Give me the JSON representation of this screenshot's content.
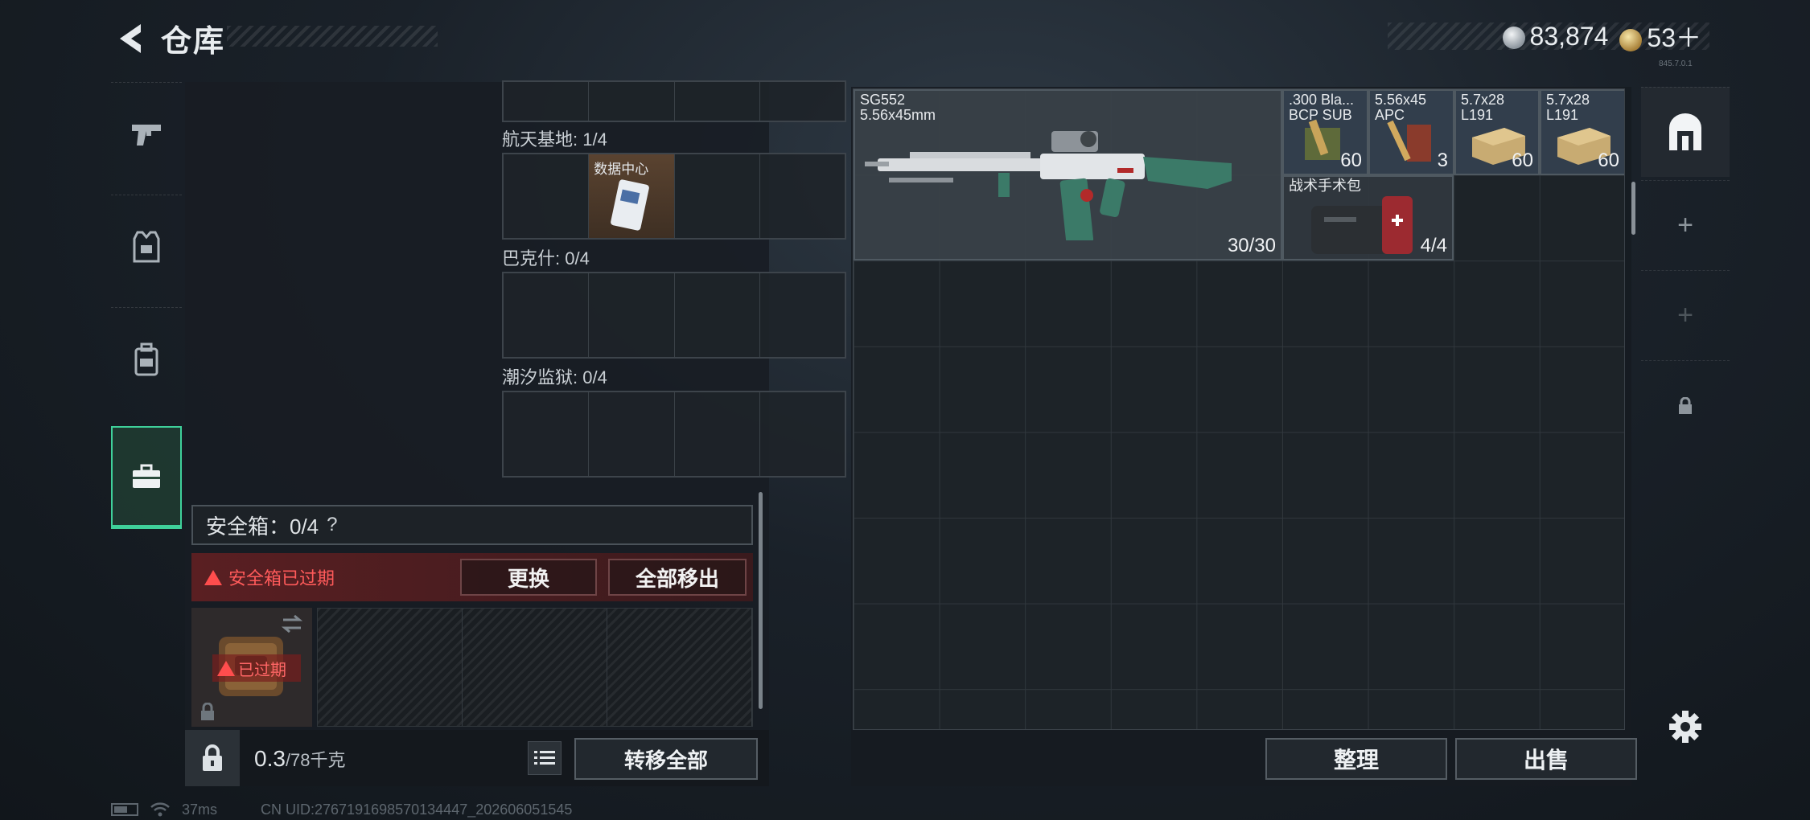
{
  "header": {
    "title": "仓库",
    "currency_silver": "83,874",
    "currency_gold": "53＋",
    "version": "845.7.0.1"
  },
  "left_tabs": [
    {
      "name": "weapons",
      "icon": "pistol-icon",
      "active": false
    },
    {
      "name": "armor",
      "icon": "vest-icon",
      "active": false
    },
    {
      "name": "backpack",
      "icon": "backpack-icon",
      "active": false
    },
    {
      "name": "safebox",
      "icon": "briefcase-icon",
      "active": true
    }
  ],
  "key_areas": [
    {
      "label": "航天基地: 1/4",
      "slots": [
        {
          "filled": false
        },
        {
          "filled": true,
          "label": "数据中心"
        },
        {
          "filled": false
        },
        {
          "filled": false
        }
      ]
    },
    {
      "label": "巴克什: 0/4",
      "slots": [
        {
          "filled": false
        },
        {
          "filled": false
        },
        {
          "filled": false
        },
        {
          "filled": false
        }
      ]
    },
    {
      "label": "潮汐监狱: 0/4",
      "slots": [
        {
          "filled": false
        },
        {
          "filled": false
        },
        {
          "filled": false
        },
        {
          "filled": false
        }
      ]
    }
  ],
  "safebox": {
    "title": "安全箱：0/4",
    "help": "?",
    "expired_text": "安全箱已过期",
    "replace_label": "更换",
    "remove_all_label": "全部移出",
    "overdue_label": "已过期"
  },
  "left_footer": {
    "weight_value": "0.3",
    "weight_max": "/78千克",
    "transfer_all_label": "转移全部"
  },
  "stash_items": [
    {
      "name": "SG552\n5.56x45mm",
      "count": "30/30",
      "type": "weapon"
    },
    {
      "name": ".300 Bla...\nBCP SUB",
      "count": "60",
      "type": "ammo"
    },
    {
      "name": "5.56x45\nAPC",
      "count": "3",
      "type": "ammo"
    },
    {
      "name": "5.7x28\nL191",
      "count": "60",
      "type": "ammo"
    },
    {
      "name": "5.7x28\nL191",
      "count": "60",
      "type": "ammo"
    },
    {
      "name": "战术手术包",
      "count": "4/4",
      "type": "medkit"
    }
  ],
  "right_footer": {
    "sort_label": "整理",
    "sell_label": "出售"
  },
  "right_column": [
    {
      "icon": "stash-icon",
      "active": true
    },
    {
      "icon": "plus-icon",
      "active": false
    },
    {
      "icon": "plus-icon",
      "active": false
    },
    {
      "icon": "lock-icon",
      "active": false
    }
  ],
  "status": {
    "ping": "37ms",
    "uid": "CN UID:2767191698570134447_202606051545"
  },
  "colors": {
    "accent_green": "#3fd09a",
    "warning_red": "#ff4d4d"
  }
}
